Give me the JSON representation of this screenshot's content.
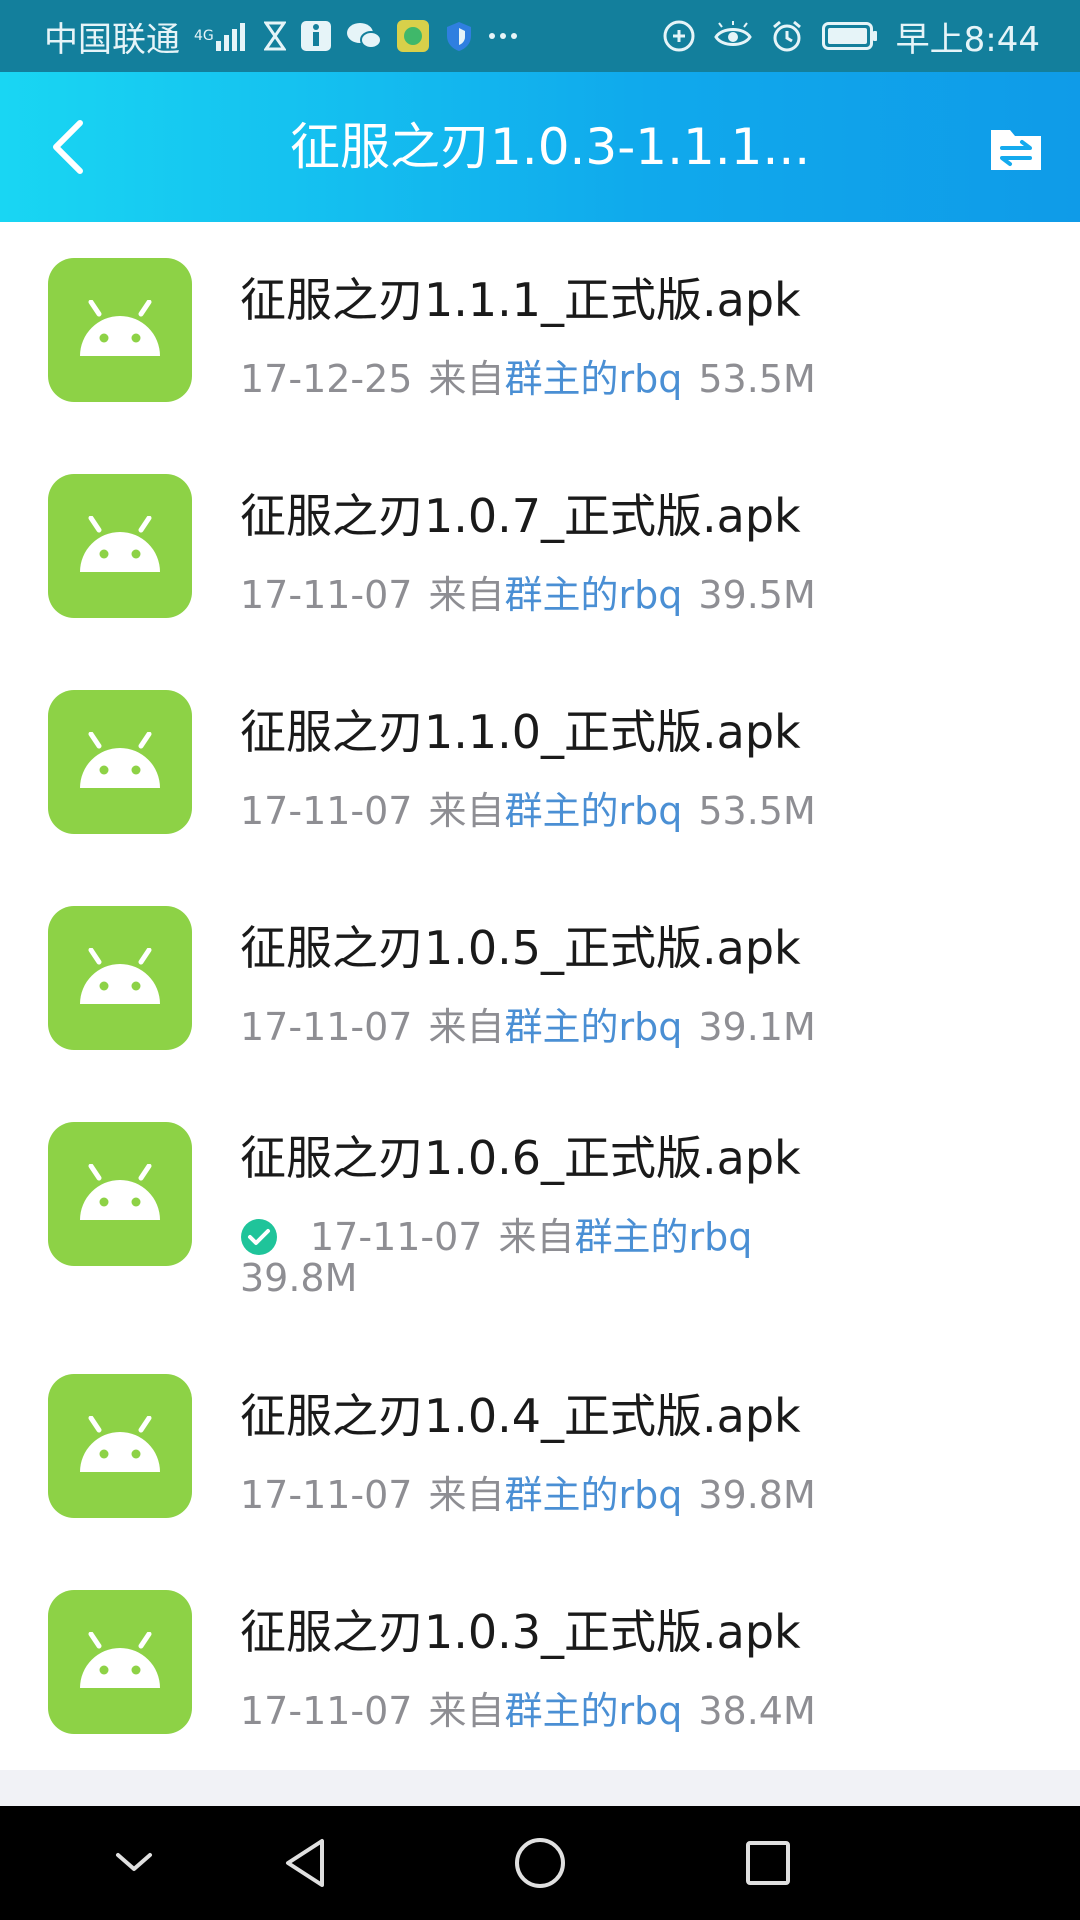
{
  "status_bar": {
    "carrier": "中国联通",
    "network": "4G",
    "time": "早上8:44"
  },
  "app_bar": {
    "title": "征服之刃1.0.3-1.1.1...",
    "back_icon": "chevron-left-icon",
    "action_icon": "folder-transfer-icon"
  },
  "files": [
    {
      "name": "征服之刃1.1.1_正式版.apk",
      "date": "17-12-25",
      "from_label": "来自",
      "from_user": "群主的rbq",
      "size": "53.5M"
    },
    {
      "name": "征服之刃1.0.7_正式版.apk",
      "date": "17-11-07",
      "from_label": "来自",
      "from_user": "群主的rbq",
      "size": "39.5M"
    },
    {
      "name": "征服之刃1.1.0_正式版.apk",
      "date": "17-11-07",
      "from_label": "来自",
      "from_user": "群主的rbq",
      "size": "53.5M"
    },
    {
      "name": "征服之刃1.0.5_正式版.apk",
      "date": "17-11-07",
      "from_label": "来自",
      "from_user": "群主的rbq",
      "size": "39.1M"
    },
    {
      "name": "征服之刃1.0.6_正式版.apk",
      "date": "17-11-07",
      "from_label": "来自",
      "from_user": "群主的rbq",
      "size": "39.8M"
    },
    {
      "name": "征服之刃1.0.4_正式版.apk",
      "date": "17-11-07",
      "from_label": "来自",
      "from_user": "群主的rbq",
      "size": "39.8M"
    },
    {
      "name": "征服之刃1.0.3_正式版.apk",
      "date": "17-11-07",
      "from_label": "来自",
      "from_user": "群主的rbq",
      "size": "38.4M"
    }
  ],
  "colors": {
    "apk_icon_bg": "#8dd246",
    "link_blue": "#4a8fd4",
    "meta_gray": "#8e8e93",
    "done_green": "#1fc49a"
  },
  "nav_bar": {
    "icons": [
      "chevron-down-icon",
      "back-triangle-icon",
      "home-circle-icon",
      "recents-square-icon"
    ]
  }
}
